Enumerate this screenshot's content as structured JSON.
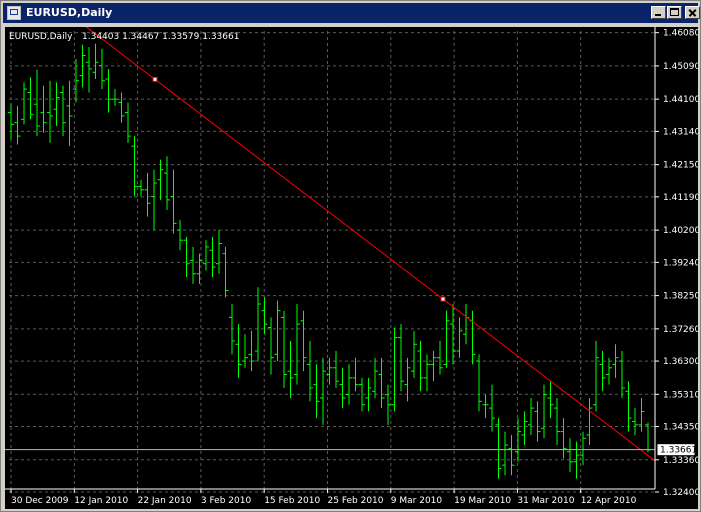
{
  "window": {
    "title": "EURUSD,Daily",
    "buttons": {
      "minimize": "minimize",
      "maximize": "maximize",
      "close": "close"
    }
  },
  "chart_data": {
    "type": "bar",
    "symbol_label": "EURUSD,Daily",
    "ohlc_label": "1.34403 1.34467 1.33579 1.33661",
    "current_price": "1.33661",
    "colors": {
      "background": "#000000",
      "bars": "#00ff00",
      "grid": "#5a5a5a",
      "trendline": "#ff0000",
      "axis_text": "#ffffff"
    },
    "grid": true,
    "ylim": [
      1.3249,
      1.4613
    ],
    "y_ticks": [
      "1.46080",
      "1.45090",
      "1.44100",
      "1.43140",
      "1.42150",
      "1.41190",
      "1.40200",
      "1.39240",
      "1.38250",
      "1.37260",
      "1.36300",
      "1.35310",
      "1.34350",
      "1.33360",
      "1.32400"
    ],
    "x_ticks": [
      "30 Dec 2009",
      "12 Jan 2010",
      "22 Jan 2010",
      "3 Feb 2010",
      "15 Feb 2010",
      "25 Feb 2010",
      "9 Mar 2010",
      "19 Mar 2010",
      "31 Mar 2010",
      "12 Apr 2010"
    ],
    "trendline": {
      "start_price": 1.4628,
      "end_price": 1.3333
    },
    "bars": [
      {
        "o": 1.437,
        "h": 1.4398,
        "l": 1.429,
        "c": 1.4335
      },
      {
        "o": 1.434,
        "h": 1.439,
        "l": 1.4275,
        "c": 1.43
      },
      {
        "o": 1.435,
        "h": 1.446,
        "l": 1.4335,
        "c": 1.444
      },
      {
        "o": 1.443,
        "h": 1.4475,
        "l": 1.435,
        "c": 1.4365
      },
      {
        "o": 1.4395,
        "h": 1.4498,
        "l": 1.43,
        "c": 1.433
      },
      {
        "o": 1.437,
        "h": 1.445,
        "l": 1.431,
        "c": 1.434
      },
      {
        "o": 1.437,
        "h": 1.4465,
        "l": 1.428,
        "c": 1.436
      },
      {
        "o": 1.438,
        "h": 1.446,
        "l": 1.433,
        "c": 1.4415
      },
      {
        "o": 1.443,
        "h": 1.445,
        "l": 1.43,
        "c": 1.434
      },
      {
        "o": 1.439,
        "h": 1.4465,
        "l": 1.427,
        "c": 1.436
      },
      {
        "o": 1.444,
        "h": 1.453,
        "l": 1.44,
        "c": 1.4465
      },
      {
        "o": 1.448,
        "h": 1.4572,
        "l": 1.4445,
        "c": 1.454
      },
      {
        "o": 1.452,
        "h": 1.4565,
        "l": 1.443,
        "c": 1.45
      },
      {
        "o": 1.449,
        "h": 1.4575,
        "l": 1.447,
        "c": 1.452
      },
      {
        "o": 1.451,
        "h": 1.456,
        "l": 1.444,
        "c": 1.4465
      },
      {
        "o": 1.447,
        "h": 1.45,
        "l": 1.437,
        "c": 1.441
      },
      {
        "o": 1.441,
        "h": 1.444,
        "l": 1.439,
        "c": 1.441
      },
      {
        "o": 1.44,
        "h": 1.443,
        "l": 1.434,
        "c": 1.436
      },
      {
        "o": 1.437,
        "h": 1.44,
        "l": 1.428,
        "c": 1.43
      },
      {
        "o": 1.427,
        "h": 1.43,
        "l": 1.412,
        "c": 1.415
      },
      {
        "o": 1.415,
        "h": 1.417,
        "l": 1.412,
        "c": 1.414
      },
      {
        "o": 1.414,
        "h": 1.419,
        "l": 1.406,
        "c": 1.41
      },
      {
        "o": 1.412,
        "h": 1.42,
        "l": 1.402,
        "c": 1.416
      },
      {
        "o": 1.417,
        "h": 1.423,
        "l": 1.411,
        "c": 1.42
      },
      {
        "o": 1.419,
        "h": 1.424,
        "l": 1.408,
        "c": 1.411
      },
      {
        "o": 1.412,
        "h": 1.42,
        "l": 1.401,
        "c": 1.404
      },
      {
        "o": 1.402,
        "h": 1.405,
        "l": 1.396,
        "c": 1.399
      },
      {
        "o": 1.399,
        "h": 1.4,
        "l": 1.388,
        "c": 1.392
      },
      {
        "o": 1.393,
        "h": 1.397,
        "l": 1.386,
        "c": 1.389
      },
      {
        "o": 1.389,
        "h": 1.395,
        "l": 1.386,
        "c": 1.393
      },
      {
        "o": 1.392,
        "h": 1.399,
        "l": 1.39,
        "c": 1.397
      },
      {
        "o": 1.396,
        "h": 1.4,
        "l": 1.388,
        "c": 1.391
      },
      {
        "o": 1.392,
        "h": 1.402,
        "l": 1.389,
        "c": 1.398
      },
      {
        "o": 1.395,
        "h": 1.397,
        "l": 1.382,
        "c": 1.384
      },
      {
        "o": 1.376,
        "h": 1.38,
        "l": 1.365,
        "c": 1.369
      },
      {
        "o": 1.368,
        "h": 1.374,
        "l": 1.358,
        "c": 1.362
      },
      {
        "o": 1.363,
        "h": 1.371,
        "l": 1.361,
        "c": 1.364
      },
      {
        "o": 1.365,
        "h": 1.372,
        "l": 1.36,
        "c": 1.363
      },
      {
        "o": 1.366,
        "h": 1.385,
        "l": 1.363,
        "c": 1.38
      },
      {
        "o": 1.378,
        "h": 1.382,
        "l": 1.371,
        "c": 1.374
      },
      {
        "o": 1.373,
        "h": 1.376,
        "l": 1.359,
        "c": 1.364
      },
      {
        "o": 1.365,
        "h": 1.381,
        "l": 1.363,
        "c": 1.378
      },
      {
        "o": 1.376,
        "h": 1.378,
        "l": 1.355,
        "c": 1.359
      },
      {
        "o": 1.36,
        "h": 1.369,
        "l": 1.352,
        "c": 1.358
      },
      {
        "o": 1.359,
        "h": 1.38,
        "l": 1.356,
        "c": 1.374
      },
      {
        "o": 1.375,
        "h": 1.378,
        "l": 1.36,
        "c": 1.364
      },
      {
        "o": 1.362,
        "h": 1.369,
        "l": 1.351,
        "c": 1.355
      },
      {
        "o": 1.356,
        "h": 1.362,
        "l": 1.346,
        "c": 1.351
      },
      {
        "o": 1.352,
        "h": 1.364,
        "l": 1.344,
        "c": 1.36
      },
      {
        "o": 1.359,
        "h": 1.364,
        "l": 1.356,
        "c": 1.361
      },
      {
        "o": 1.361,
        "h": 1.366,
        "l": 1.355,
        "c": 1.357
      },
      {
        "o": 1.356,
        "h": 1.361,
        "l": 1.349,
        "c": 1.352
      },
      {
        "o": 1.353,
        "h": 1.362,
        "l": 1.35,
        "c": 1.358
      },
      {
        "o": 1.358,
        "h": 1.364,
        "l": 1.354,
        "c": 1.356
      },
      {
        "o": 1.356,
        "h": 1.358,
        "l": 1.348,
        "c": 1.35
      },
      {
        "o": 1.352,
        "h": 1.358,
        "l": 1.348,
        "c": 1.355
      },
      {
        "o": 1.354,
        "h": 1.364,
        "l": 1.352,
        "c": 1.36
      },
      {
        "o": 1.359,
        "h": 1.364,
        "l": 1.349,
        "c": 1.352
      },
      {
        "o": 1.353,
        "h": 1.356,
        "l": 1.344,
        "c": 1.35
      },
      {
        "o": 1.35,
        "h": 1.373,
        "l": 1.348,
        "c": 1.37
      },
      {
        "o": 1.37,
        "h": 1.374,
        "l": 1.354,
        "c": 1.357
      },
      {
        "o": 1.356,
        "h": 1.364,
        "l": 1.351,
        "c": 1.361
      },
      {
        "o": 1.36,
        "h": 1.372,
        "l": 1.358,
        "c": 1.368
      },
      {
        "o": 1.366,
        "h": 1.369,
        "l": 1.354,
        "c": 1.358
      },
      {
        "o": 1.358,
        "h": 1.365,
        "l": 1.354,
        "c": 1.362
      },
      {
        "o": 1.362,
        "h": 1.366,
        "l": 1.357,
        "c": 1.364
      },
      {
        "o": 1.364,
        "h": 1.369,
        "l": 1.359,
        "c": 1.361
      },
      {
        "o": 1.362,
        "h": 1.378,
        "l": 1.361,
        "c": 1.375
      },
      {
        "o": 1.374,
        "h": 1.38,
        "l": 1.362,
        "c": 1.366
      },
      {
        "o": 1.366,
        "h": 1.376,
        "l": 1.364,
        "c": 1.372
      },
      {
        "o": 1.371,
        "h": 1.38,
        "l": 1.368,
        "c": 1.376
      },
      {
        "o": 1.375,
        "h": 1.378,
        "l": 1.362,
        "c": 1.365
      },
      {
        "o": 1.363,
        "h": 1.365,
        "l": 1.348,
        "c": 1.351
      },
      {
        "o": 1.35,
        "h": 1.353,
        "l": 1.346,
        "c": 1.35
      },
      {
        "o": 1.349,
        "h": 1.356,
        "l": 1.342,
        "c": 1.346
      },
      {
        "o": 1.344,
        "h": 1.346,
        "l": 1.328,
        "c": 1.331
      },
      {
        "o": 1.332,
        "h": 1.342,
        "l": 1.329,
        "c": 1.338
      },
      {
        "o": 1.337,
        "h": 1.341,
        "l": 1.329,
        "c": 1.332
      },
      {
        "o": 1.336,
        "h": 1.346,
        "l": 1.333,
        "c": 1.342
      },
      {
        "o": 1.341,
        "h": 1.348,
        "l": 1.338,
        "c": 1.345
      },
      {
        "o": 1.344,
        "h": 1.352,
        "l": 1.341,
        "c": 1.349
      },
      {
        "o": 1.348,
        "h": 1.351,
        "l": 1.339,
        "c": 1.342
      },
      {
        "o": 1.343,
        "h": 1.356,
        "l": 1.34,
        "c": 1.353
      },
      {
        "o": 1.352,
        "h": 1.357,
        "l": 1.346,
        "c": 1.35
      },
      {
        "o": 1.349,
        "h": 1.352,
        "l": 1.338,
        "c": 1.342
      },
      {
        "o": 1.342,
        "h": 1.346,
        "l": 1.334,
        "c": 1.337
      },
      {
        "o": 1.336,
        "h": 1.34,
        "l": 1.33,
        "c": 1.333
      },
      {
        "o": 1.333,
        "h": 1.339,
        "l": 1.328,
        "c": 1.335
      },
      {
        "o": 1.335,
        "h": 1.342,
        "l": 1.332,
        "c": 1.34
      },
      {
        "o": 1.341,
        "h": 1.352,
        "l": 1.338,
        "c": 1.349
      },
      {
        "o": 1.35,
        "h": 1.369,
        "l": 1.348,
        "c": 1.364
      },
      {
        "o": 1.362,
        "h": 1.366,
        "l": 1.354,
        "c": 1.358
      },
      {
        "o": 1.359,
        "h": 1.364,
        "l": 1.356,
        "c": 1.361
      },
      {
        "o": 1.362,
        "h": 1.368,
        "l": 1.358,
        "c": 1.364
      },
      {
        "o": 1.363,
        "h": 1.366,
        "l": 1.352,
        "c": 1.355
      },
      {
        "o": 1.354,
        "h": 1.357,
        "l": 1.342,
        "c": 1.346
      },
      {
        "o": 1.345,
        "h": 1.349,
        "l": 1.341,
        "c": 1.344
      },
      {
        "o": 1.344,
        "h": 1.352,
        "l": 1.342,
        "c": 1.348
      },
      {
        "o": 1.344,
        "h": 1.3447,
        "l": 1.3358,
        "c": 1.3366
      }
    ]
  }
}
